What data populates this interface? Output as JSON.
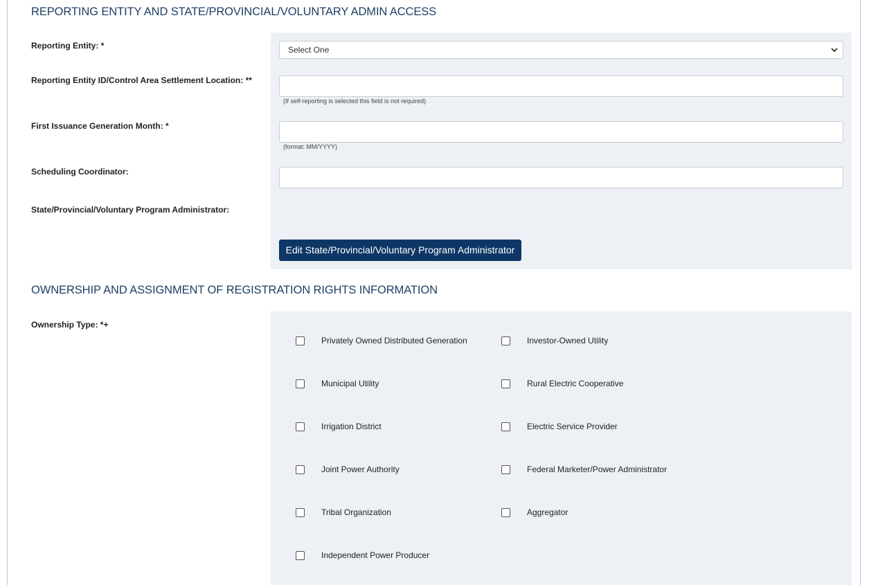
{
  "section1": {
    "title": "REPORTING ENTITY AND STATE/PROVINCIAL/VOLUNTARY ADMIN ACCESS",
    "reporting_entity": {
      "label": "Reporting Entity: *",
      "value": "Select One"
    },
    "reporting_entity_id": {
      "label": "Reporting Entity ID/Control Area Settlement Location: **",
      "value": "",
      "hint": "(If self-reporting is selected this field is not required)"
    },
    "first_issuance": {
      "label": "First Issuance Generation Month: *",
      "value": "",
      "hint": "(format: MM/YYYY)"
    },
    "scheduling_coordinator": {
      "label": "Scheduling Coordinator:",
      "value": ""
    },
    "program_admin": {
      "label": "State/Provincial/Voluntary Program Administrator:"
    },
    "edit_button": "Edit State/Provincial/Voluntary Program Administrator"
  },
  "section2": {
    "title": "OWNERSHIP AND ASSIGNMENT OF REGISTRATION RIGHTS INFORMATION",
    "ownership_label": "Ownership Type: *+",
    "options": [
      "Privately Owned Distributed Generation",
      "Investor-Owned Utility",
      "Municipal Utility",
      "Rural Electric Cooperative",
      "Irrigation District",
      "Electric Service Provider",
      "Joint Power Authority",
      "Federal Marketer/Power Administrator",
      "Tribal Organization",
      "Aggregator",
      "Independent Power Producer"
    ],
    "checked": [
      false,
      false,
      false,
      false,
      false,
      false,
      false,
      false,
      false,
      false,
      false
    ]
  },
  "icons": {
    "select_arrow": "chevron-down-icon"
  },
  "colors": {
    "button_bg": "#0e3766",
    "panel_bg": "#edf0f5",
    "title": "#1f3f66"
  }
}
